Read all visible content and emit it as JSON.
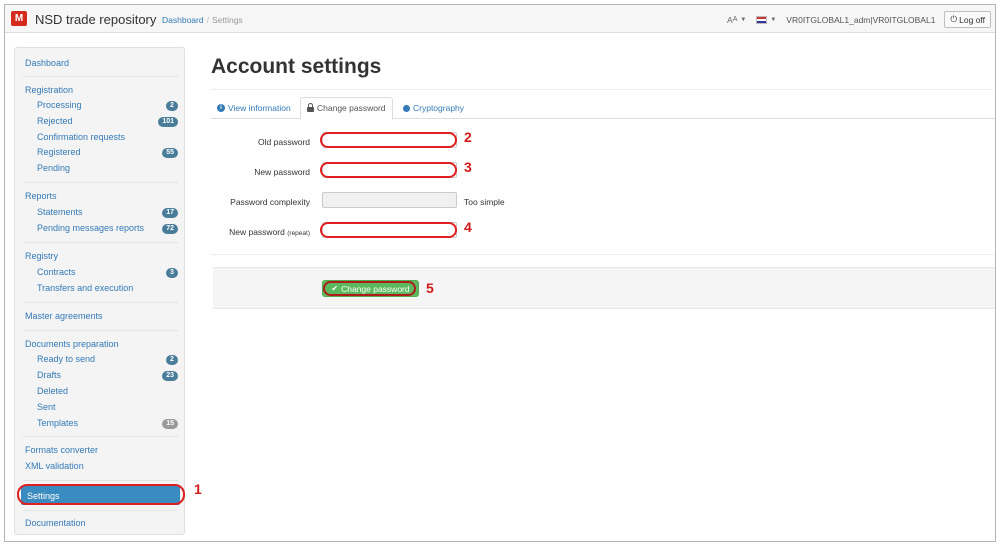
{
  "app": {
    "logo_glyph": "M",
    "brand": "NSD trade repository",
    "breadcrumb": [
      "Dashboard",
      "Settings"
    ],
    "font_control": "A",
    "user": "VR0ITGLOBAL1_adm|VR0ITGLOBAL1",
    "logoff": "Log off",
    "accent_color": "#337ab7",
    "brand_color": "#d52b1e"
  },
  "sidebar": {
    "dashboard": "Dashboard",
    "registration": {
      "heading": "Registration",
      "items": [
        {
          "label": "Processing",
          "badge": "2"
        },
        {
          "label": "Rejected",
          "badge": "101"
        },
        {
          "label": "Confirmation requests",
          "badge": ""
        },
        {
          "label": "Registered",
          "badge": "55"
        },
        {
          "label": "Pending",
          "badge": ""
        }
      ]
    },
    "reports": {
      "heading": "Reports",
      "items": [
        {
          "label": "Statements",
          "badge": "17"
        },
        {
          "label": "Pending messages reports",
          "badge": "72"
        }
      ]
    },
    "registry": {
      "heading": "Registry",
      "items": [
        {
          "label": "Contracts",
          "badge": "3"
        },
        {
          "label": "Transfers and execution",
          "badge": ""
        }
      ]
    },
    "master_agreements": "Master agreements",
    "documents": {
      "heading": "Documents preparation",
      "items": [
        {
          "label": "Ready to send",
          "badge": "2"
        },
        {
          "label": "Drafts",
          "badge": "23"
        },
        {
          "label": "Deleted",
          "badge": ""
        },
        {
          "label": "Sent",
          "badge": ""
        },
        {
          "label": "Templates",
          "badge": "15"
        }
      ]
    },
    "formats_converter": "Formats converter",
    "xml_validation": "XML validation",
    "settings": "Settings",
    "documentation": "Documentation"
  },
  "main": {
    "title": "Account settings",
    "tabs": [
      "View information",
      "Change password",
      "Cryptography"
    ],
    "fields": {
      "old_password": "Old password",
      "new_password": "New password",
      "complexity": "Password complexity",
      "complexity_value": "Too simple",
      "repeat_label": "New password",
      "repeat_suffix": "(repeat)"
    },
    "submit": "Change password"
  },
  "annotations": [
    "1",
    "2",
    "3",
    "4",
    "5"
  ]
}
